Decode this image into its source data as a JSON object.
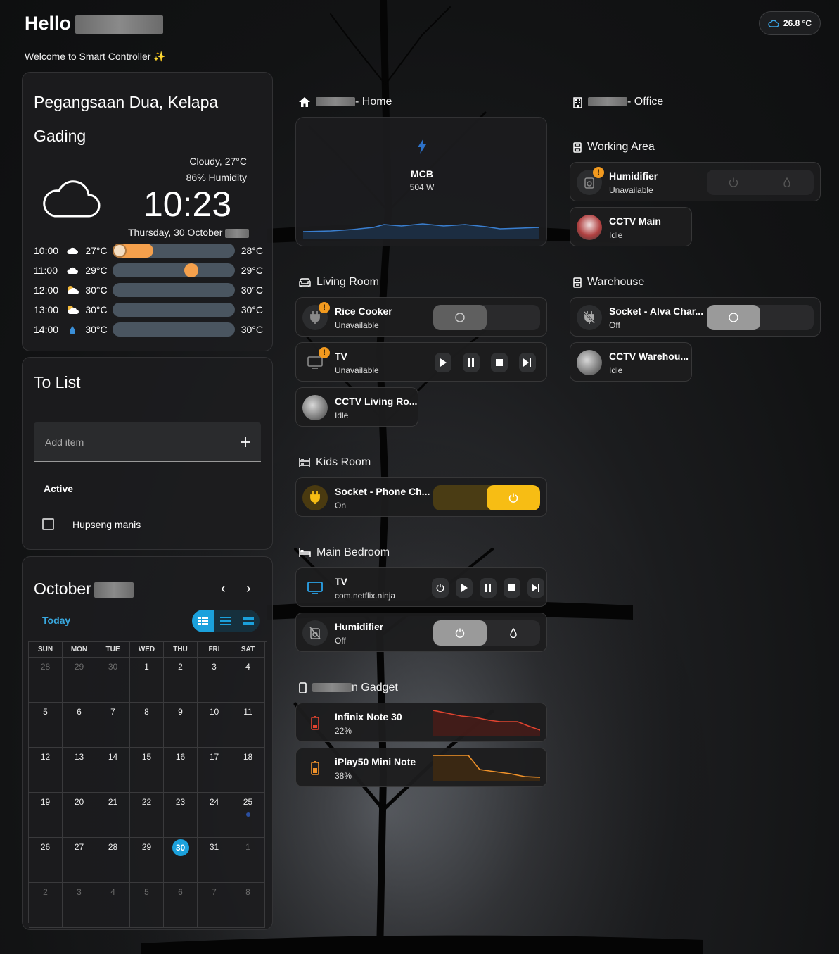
{
  "header": {
    "greeting": "Hello",
    "welcome": "Welcome to Smart Controller ✨",
    "outdoor_temp": "26.8 °C"
  },
  "weather": {
    "location": "Pegangsaan Dua, Kelapa Gading",
    "condition": "Cloudy, 27°C",
    "humidity": "86% Humidity",
    "time": "10:23",
    "date": "Thursday, 30 October",
    "forecast": [
      {
        "time": "10:00",
        "icon": "cloud-icon",
        "low": "27°C",
        "high": "28°C",
        "level": 0.12
      },
      {
        "time": "11:00",
        "icon": "cloud-icon",
        "low": "29°C",
        "high": "29°C",
        "level": 0.65
      },
      {
        "time": "12:00",
        "icon": "partly-sunny-icon",
        "low": "30°C",
        "high": "30°C",
        "level": 0
      },
      {
        "time": "13:00",
        "icon": "partly-sunny-icon",
        "low": "30°C",
        "high": "30°C",
        "level": 0
      },
      {
        "time": "14:00",
        "icon": "rain-drop-icon",
        "low": "30°C",
        "high": "30°C",
        "level": 0
      }
    ]
  },
  "todo": {
    "title": "To List",
    "add_placeholder": "Add item",
    "active_label": "Active",
    "items": [
      "Hupseng manis"
    ]
  },
  "calendar": {
    "month": "October",
    "today_label": "Today",
    "weekdays": [
      "SUN",
      "MON",
      "TUE",
      "WED",
      "THU",
      "FRI",
      "SAT"
    ],
    "weeks": [
      [
        "28",
        "29",
        "30",
        "1",
        "2",
        "3",
        "4"
      ],
      [
        "5",
        "6",
        "7",
        "8",
        "9",
        "10",
        "11"
      ],
      [
        "12",
        "13",
        "14",
        "15",
        "16",
        "17",
        "18"
      ],
      [
        "19",
        "20",
        "21",
        "22",
        "23",
        "24",
        "25"
      ],
      [
        "26",
        "27",
        "28",
        "29",
        "30",
        "31",
        "1"
      ],
      [
        "2",
        "3",
        "4",
        "5",
        "6",
        "7",
        "8"
      ]
    ],
    "today": "30",
    "event_day": "25"
  },
  "home": {
    "title": "- Home",
    "mcb_name": "MCB",
    "mcb_power": "504 W"
  },
  "living_room": {
    "title": "Living Room",
    "rice_cooker": {
      "name": "Rice Cooker",
      "state": "Unavailable"
    },
    "tv": {
      "name": "TV",
      "state": "Unavailable"
    },
    "cctv": {
      "name": "CCTV Living Ro...",
      "state": "Idle"
    }
  },
  "kids_room": {
    "title": "Kids Room",
    "socket": {
      "name": "Socket - Phone Ch...",
      "state": "On"
    }
  },
  "main_bedroom": {
    "title": "Main Bedroom",
    "tv": {
      "name": "TV",
      "state": "com.netflix.ninja"
    },
    "humidifier": {
      "name": "Humidifier",
      "state": "Off"
    }
  },
  "gadget": {
    "title": "n Gadget",
    "phones": [
      {
        "name": "Infinix Note 30",
        "battery": "22%",
        "color": "#e0432f"
      },
      {
        "name": "iPlay50 Mini Note",
        "battery": "38%",
        "color": "#f0922a"
      }
    ]
  },
  "office": {
    "title": "- Office",
    "working_area_title": "Working Area",
    "humidifier": {
      "name": "Humidifier",
      "state": "Unavailable"
    },
    "cctv_main": {
      "name": "CCTV Main",
      "state": "Idle"
    },
    "warehouse_title": "Warehouse",
    "socket": {
      "name": "Socket - Alva Char...",
      "state": "Off"
    },
    "cctv_warehouse": {
      "name": "CCTV Warehou...",
      "state": "Idle"
    }
  },
  "colors": {
    "accent": "#1ba1dc",
    "warning": "#f29a1f",
    "on_yellow": "#f7bd14",
    "forecast_fill": "#f5a04c"
  }
}
